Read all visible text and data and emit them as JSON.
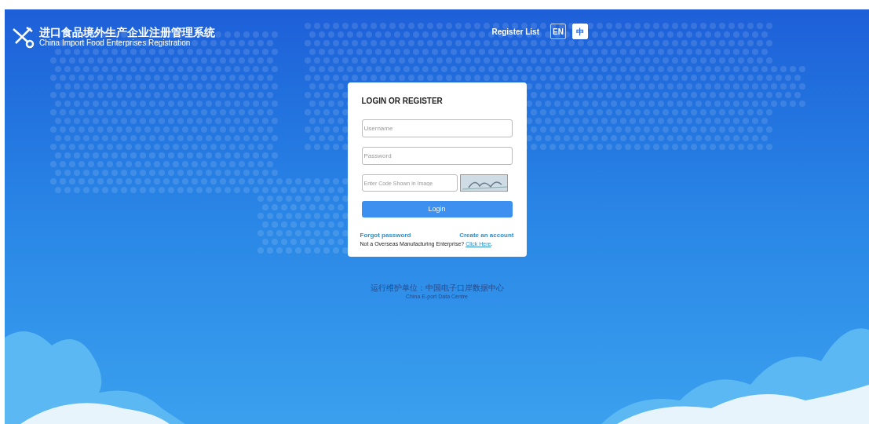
{
  "header": {
    "title": "进口食品境外生产企业注册管理系统",
    "subtitle": "China Import Food Enterprises Registration",
    "register_list": "Register List",
    "languages": [
      {
        "label": "EN",
        "selected": false
      },
      {
        "label": "中",
        "selected": true
      }
    ]
  },
  "login": {
    "heading": "LOGIN OR REGISTER",
    "username": {
      "placeholder": "Username"
    },
    "password": {
      "placeholder": "Password"
    },
    "captcha": {
      "placeholder": "Enter Code Shown in Image"
    },
    "button": "Login",
    "forgot": "Forgot password",
    "create": "Create an account",
    "note": "Not a Overseas Manufacturing Enterprise?",
    "note_link": "Click Here",
    "note_end": "."
  },
  "footer": {
    "line1": "运行维护单位：中国电子口岸数据中心",
    "line2": "China E-port Data Centre"
  }
}
